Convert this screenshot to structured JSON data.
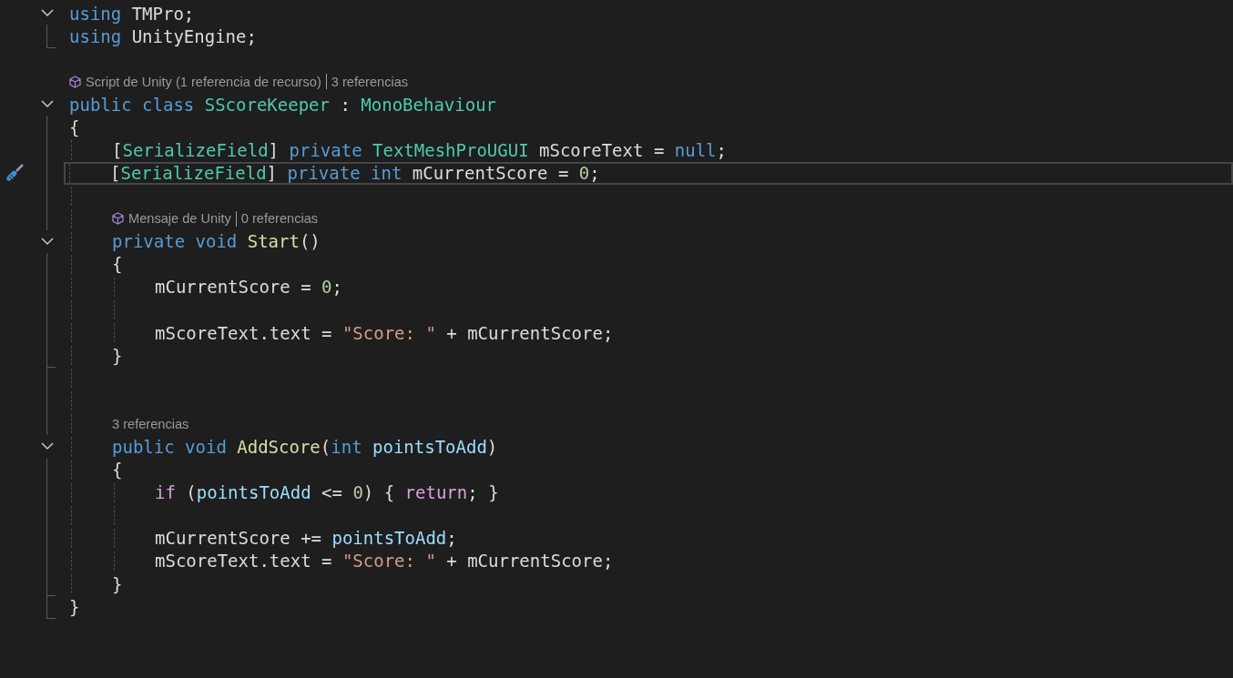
{
  "editor": {
    "lines": [
      {
        "kind": "region",
        "expanded": true,
        "lines": [
          {
            "kind": "code",
            "tokens": [
              {
                "kind": "keyword",
                "text": "using "
              },
              {
                "kind": "plain",
                "text": "TMPro;"
              }
            ]
          },
          {
            "kind": "code",
            "tokens": [
              {
                "kind": "keyword",
                "text": "using "
              },
              {
                "kind": "plain",
                "text": "UnityEngine;"
              }
            ]
          }
        ]
      },
      {
        "kind": "blank"
      },
      {
        "kind": "lens",
        "links": [
          {
            "kind": "unity",
            "text": "Script de Unity (1 referencia de recurso)"
          },
          {
            "kind": "refs",
            "text": "3 referencias"
          }
        ]
      },
      {
        "kind": "region",
        "expanded": true,
        "lines": [
          {
            "kind": "code",
            "tokens": [
              {
                "kind": "keyword",
                "text": "public class "
              },
              {
                "kind": "type",
                "text": "SScoreKeeper"
              },
              {
                "kind": "plain",
                "text": " : "
              },
              {
                "kind": "type",
                "text": "MonoBehaviour"
              }
            ]
          },
          {
            "kind": "code",
            "tokens": [
              {
                "kind": "plain",
                "text": "{"
              }
            ]
          },
          {
            "kind": "block",
            "lines": [
              {
                "kind": "code",
                "tokens": [
                  {
                    "kind": "plain",
                    "text": "["
                  },
                  {
                    "kind": "type",
                    "text": "SerializeField"
                  },
                  {
                    "kind": "plain",
                    "text": "] "
                  },
                  {
                    "kind": "keyword",
                    "text": "private "
                  },
                  {
                    "kind": "type",
                    "text": "TextMeshProUGUI"
                  },
                  {
                    "kind": "plain",
                    "text": " mScoreText = "
                  },
                  {
                    "kind": "keyword",
                    "text": "null"
                  },
                  {
                    "kind": "plain",
                    "text": ";"
                  }
                ]
              },
              {
                "kind": "code",
                "current": true,
                "quick_actions": true,
                "tokens": [
                  {
                    "kind": "plain",
                    "text": "["
                  },
                  {
                    "kind": "type",
                    "text": "SerializeField"
                  },
                  {
                    "kind": "plain",
                    "text": "] "
                  },
                  {
                    "kind": "keyword",
                    "text": "private int"
                  },
                  {
                    "kind": "plain",
                    "text": " mCurrentScore = "
                  },
                  {
                    "kind": "number",
                    "text": "0"
                  },
                  {
                    "kind": "plain",
                    "text": ";"
                  }
                ]
              },
              {
                "kind": "blank"
              },
              {
                "kind": "lens",
                "links": [
                  {
                    "kind": "unity",
                    "text": "Mensaje de Unity"
                  },
                  {
                    "kind": "refs",
                    "text": "0 referencias"
                  }
                ]
              },
              {
                "kind": "region",
                "expanded": true,
                "lines": [
                  {
                    "kind": "code",
                    "tokens": [
                      {
                        "kind": "keyword",
                        "text": "private void "
                      },
                      {
                        "kind": "method",
                        "text": "Start"
                      },
                      {
                        "kind": "plain",
                        "text": "()"
                      }
                    ]
                  },
                  {
                    "kind": "code",
                    "tokens": [
                      {
                        "kind": "plain",
                        "text": "{"
                      }
                    ]
                  },
                  {
                    "kind": "block",
                    "lines": [
                      {
                        "kind": "code",
                        "tokens": [
                          {
                            "kind": "plain",
                            "text": "mCurrentScore = "
                          },
                          {
                            "kind": "number",
                            "text": "0"
                          },
                          {
                            "kind": "plain",
                            "text": ";"
                          }
                        ]
                      },
                      {
                        "kind": "blank"
                      },
                      {
                        "kind": "code",
                        "tokens": [
                          {
                            "kind": "plain",
                            "text": "mScoreText.text = "
                          },
                          {
                            "kind": "string",
                            "text": "\"Score: \""
                          },
                          {
                            "kind": "plain",
                            "text": " + mCurrentScore;"
                          }
                        ]
                      }
                    ]
                  },
                  {
                    "kind": "code",
                    "tokens": [
                      {
                        "kind": "plain",
                        "text": "}"
                      }
                    ]
                  }
                ]
              },
              {
                "kind": "blank"
              },
              {
                "kind": "blank"
              },
              {
                "kind": "lens",
                "links": [
                  {
                    "kind": "refs",
                    "text": "3 referencias"
                  }
                ]
              },
              {
                "kind": "region",
                "expanded": true,
                "lines": [
                  {
                    "kind": "code",
                    "tokens": [
                      {
                        "kind": "keyword",
                        "text": "public void "
                      },
                      {
                        "kind": "method",
                        "text": "AddScore"
                      },
                      {
                        "kind": "plain",
                        "text": "("
                      },
                      {
                        "kind": "keyword",
                        "text": "int "
                      },
                      {
                        "kind": "param",
                        "text": "pointsToAdd"
                      },
                      {
                        "kind": "plain",
                        "text": ")"
                      }
                    ]
                  },
                  {
                    "kind": "code",
                    "tokens": [
                      {
                        "kind": "plain",
                        "text": "{"
                      }
                    ]
                  },
                  {
                    "kind": "block",
                    "lines": [
                      {
                        "kind": "code",
                        "tokens": [
                          {
                            "kind": "control",
                            "text": "if "
                          },
                          {
                            "kind": "plain",
                            "text": "("
                          },
                          {
                            "kind": "param",
                            "text": "pointsToAdd"
                          },
                          {
                            "kind": "plain",
                            "text": " <= "
                          },
                          {
                            "kind": "number",
                            "text": "0"
                          },
                          {
                            "kind": "plain",
                            "text": ") { "
                          },
                          {
                            "kind": "control",
                            "text": "return"
                          },
                          {
                            "kind": "plain",
                            "text": "; }"
                          }
                        ]
                      },
                      {
                        "kind": "blank"
                      },
                      {
                        "kind": "code",
                        "tokens": [
                          {
                            "kind": "plain",
                            "text": "mCurrentScore += "
                          },
                          {
                            "kind": "param",
                            "text": "pointsToAdd"
                          },
                          {
                            "kind": "plain",
                            "text": ";"
                          }
                        ]
                      },
                      {
                        "kind": "code",
                        "tokens": [
                          {
                            "kind": "plain",
                            "text": "mScoreText.text = "
                          },
                          {
                            "kind": "string",
                            "text": "\"Score: \""
                          },
                          {
                            "kind": "plain",
                            "text": " + mCurrentScore;"
                          }
                        ]
                      }
                    ]
                  },
                  {
                    "kind": "code",
                    "tokens": [
                      {
                        "kind": "plain",
                        "text": "}"
                      }
                    ]
                  }
                ]
              }
            ]
          },
          {
            "kind": "code",
            "tokens": [
              {
                "kind": "plain",
                "text": "}"
              }
            ]
          }
        ]
      }
    ]
  }
}
